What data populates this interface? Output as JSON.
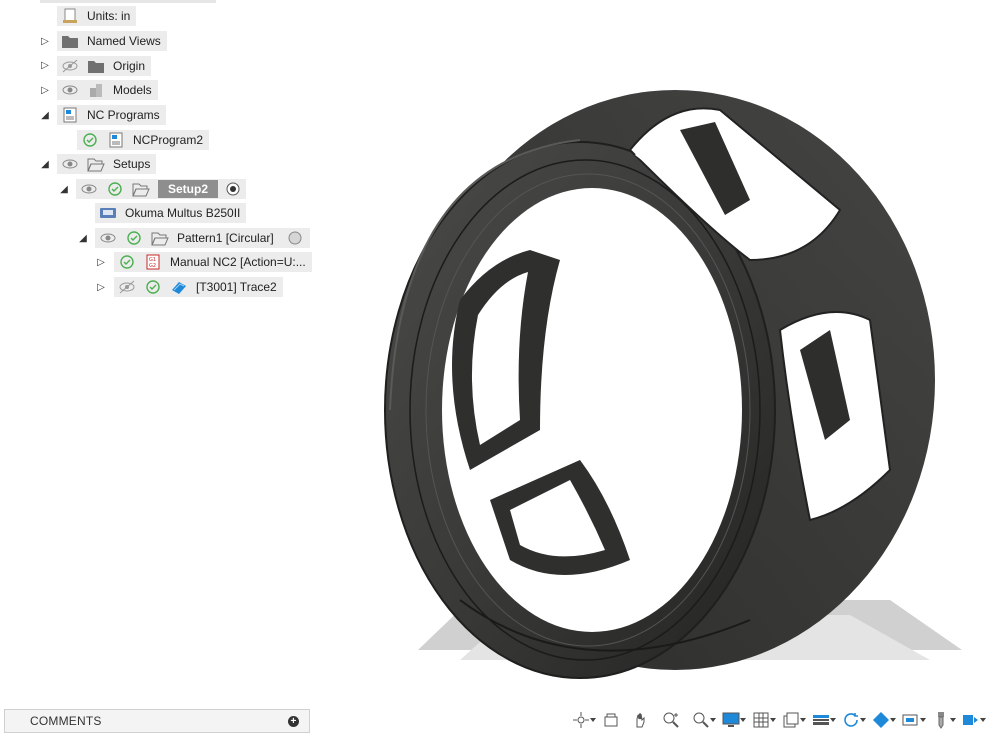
{
  "browser": {
    "nodes": {
      "units": "Units: in",
      "named_views": "Named Views",
      "origin": "Origin",
      "models": "Models",
      "nc_programs": "NC Programs",
      "ncprogram2": "NCProgram2",
      "setups": "Setups",
      "setup2": "Setup2",
      "machine": "Okuma Multus B250II",
      "pattern": "Pattern1 [Circular]",
      "manual_nc": "Manual NC2 [Action=U:...",
      "trace": "[T3001] Trace2"
    }
  },
  "comments": {
    "label": "COMMENTS"
  },
  "navbar": {
    "icons": [
      "orbit-icon",
      "look-at-icon",
      "pan-icon",
      "zoom-icon",
      "zoom-window-icon",
      "display-settings-icon",
      "grid-icon",
      "viewports-icon",
      "environment-icon",
      "orbit-free-icon",
      "visual-style-icon",
      "camera-icon",
      "tool-icon",
      "hide-panel-icon"
    ]
  },
  "colors": {
    "accent_blue": "#1e88d9",
    "check_green": "#4caf50",
    "selected_bg": "#8e8e8e",
    "model_dark": "#3a3a38"
  }
}
